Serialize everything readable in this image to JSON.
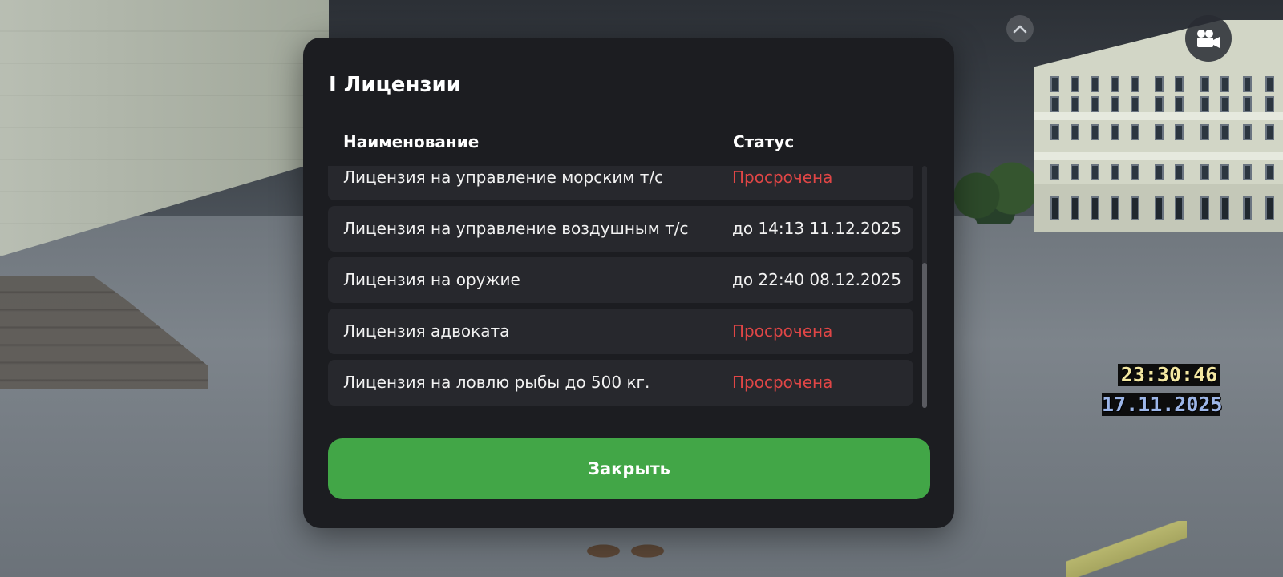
{
  "modal": {
    "title": "I Лицензии",
    "columns": {
      "name": "Наименование",
      "status": "Статус"
    },
    "licenses": [
      {
        "name": "Лицензия на управление морским т/с",
        "status": "Просрочена",
        "expired": true
      },
      {
        "name": "Лицензия на управление воздушным т/с",
        "status": "до 14:13 11.12.2025",
        "expired": false
      },
      {
        "name": "Лицензия на оружие",
        "status": "до 22:40 08.12.2025",
        "expired": false
      },
      {
        "name": "Лицензия адвоката",
        "status": "Просрочена",
        "expired": true
      },
      {
        "name": "Лицензия на ловлю рыбы до 500 кг.",
        "status": "Просрочена",
        "expired": true
      }
    ],
    "close_label": "Закрыть"
  },
  "hud": {
    "time": "23:30:46",
    "date": "17.11.2025",
    "icons": [
      "chevron-up-icon",
      "video-camera-icon"
    ]
  },
  "colors": {
    "panel": "#1c1d21",
    "row": "#27282d",
    "expired": "#e04646",
    "accent_green": "#42a647",
    "clock_text": "#f4e8a2",
    "date_text": "#9db6e8"
  }
}
